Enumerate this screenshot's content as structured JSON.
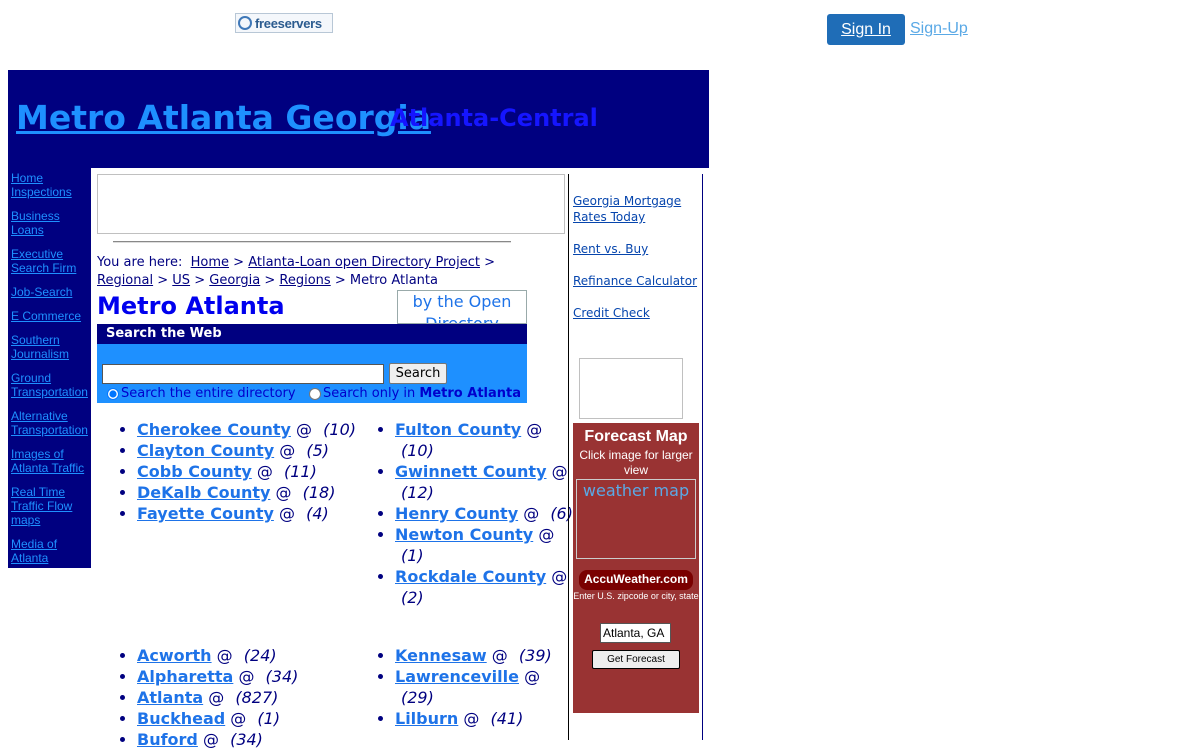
{
  "topbar": {
    "logo_text": "freeservers",
    "signin_label": "Sign In",
    "signup_label": "Sign-Up"
  },
  "header": {
    "title": "Metro Atlanta Georgia",
    "subtitle": "Atlanta-Central"
  },
  "leftnav": {
    "items": [
      "Home Inspections",
      "Business Loans",
      "Executive Search Firm",
      "Job-Search",
      "E Commerce",
      "Southern Journalism",
      "Ground Transportation",
      "Alternative Transportation",
      "Images of Atlanta Traffic",
      "Real Time Traffic Flow maps",
      "Media of Atlanta"
    ]
  },
  "breadcrumb": {
    "prefix": "You are here:",
    "items": [
      "Home",
      "Atlanta-Loan open Directory Project",
      "Regional",
      "US",
      "Georgia",
      "Regions"
    ],
    "current": "Metro Atlanta",
    "separator": ">"
  },
  "main": {
    "heading": "Metro Atlanta",
    "odp_badge_alt": "by the Open Directory"
  },
  "search": {
    "header": "Search the Web",
    "input_value": "",
    "button_label": "Search",
    "radio_all_label": "Search the entire directory",
    "radio_only_label": "Search only in",
    "radio_only_target": "Metro Atlanta"
  },
  "counties": {
    "col1": [
      {
        "name": "Cherokee County",
        "count": "(10)"
      },
      {
        "name": "Clayton County",
        "count": "(5)"
      },
      {
        "name": "Cobb County",
        "count": "(11)"
      },
      {
        "name": "DeKalb County",
        "count": "(18)"
      },
      {
        "name": "Fayette County",
        "count": "(4)"
      }
    ],
    "col2": [
      {
        "name": "Fulton County",
        "count": "(10)"
      },
      {
        "name": "Gwinnett County",
        "count": "(12)"
      },
      {
        "name": "Henry County",
        "count": "(6)"
      },
      {
        "name": "Newton County",
        "count": "(1)"
      },
      {
        "name": "Rockdale County",
        "count": "(2)"
      }
    ],
    "at": "@"
  },
  "cities": {
    "col1": [
      {
        "name": "Acworth",
        "count": "(24)"
      },
      {
        "name": "Alpharetta",
        "count": "(34)"
      },
      {
        "name": "Atlanta",
        "count": "(827)"
      },
      {
        "name": "Buckhead",
        "count": "(1)"
      },
      {
        "name": "Buford",
        "count": "(34)"
      }
    ],
    "col2": [
      {
        "name": "Kennesaw",
        "count": "(39)"
      },
      {
        "name": "Lawrenceville",
        "count": "(29)"
      },
      {
        "name": "Lilburn",
        "count": "(41)"
      }
    ]
  },
  "rightcol": {
    "links": [
      "Georgia Mortgage Rates Today",
      "Rent vs. Buy",
      "Refinance Calculator",
      "Credit Check"
    ]
  },
  "weather": {
    "title": "Forecast Map",
    "subtitle": "Click image for larger view",
    "map_alt": "weather map",
    "brand": "AccuWeather.com",
    "hint": "Enter U.S. zipcode or city, state",
    "input_value": "Atlanta, GA",
    "button_label": "Get Forecast"
  },
  "colors": {
    "banner": "#000080",
    "link_bright": "#1e90ff",
    "weather_bg": "#993333",
    "signin_bg": "#1f6db7"
  }
}
